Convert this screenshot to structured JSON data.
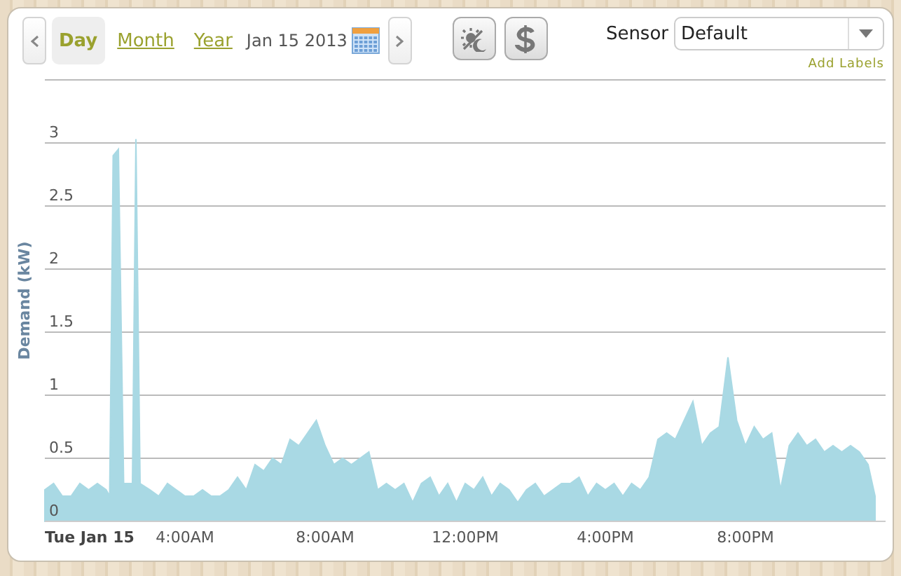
{
  "tabs": [
    {
      "label": "Day",
      "selected": true
    },
    {
      "label": "Month",
      "selected": false
    },
    {
      "label": "Year",
      "selected": false
    }
  ],
  "date": "Jan 15 2013",
  "sensor": {
    "label": "Sensor",
    "value": "Default"
  },
  "add_labels": "Add Labels",
  "chart_data": {
    "type": "area",
    "ylabel": "Demand (kW)",
    "x": [
      0,
      0.25,
      0.5,
      0.75,
      1,
      1.25,
      1.5,
      1.75,
      1.85,
      1.95,
      2.1,
      2.25,
      2.5,
      2.6,
      2.72,
      3,
      3.25,
      3.5,
      3.75,
      4,
      4.25,
      4.5,
      4.75,
      5,
      5.25,
      5.5,
      5.75,
      6,
      6.25,
      6.5,
      6.75,
      7,
      7.25,
      7.5,
      7.75,
      8,
      8.25,
      8.5,
      8.75,
      9,
      9.25,
      9.5,
      9.75,
      10,
      10.25,
      10.5,
      10.75,
      11,
      11.25,
      11.5,
      11.75,
      12,
      12.25,
      12.5,
      12.75,
      13,
      13.25,
      13.5,
      13.75,
      14,
      14.25,
      14.5,
      14.75,
      15,
      15.25,
      15.5,
      15.75,
      16,
      16.25,
      16.5,
      16.75,
      17,
      17.25,
      17.5,
      17.75,
      18,
      18.25,
      18.5,
      18.75,
      19,
      19.25,
      19.5,
      19.75,
      20,
      20.25,
      20.5,
      20.75,
      21,
      21.25,
      21.5,
      21.75,
      22,
      22.25,
      22.5,
      22.75,
      23,
      23.25,
      23.5,
      23.7
    ],
    "grid": true,
    "series": [
      {
        "color": "#a9d9e4",
        "values": [
          0.25,
          0.3,
          0.2,
          0.2,
          0.3,
          0.25,
          0.3,
          0.25,
          0.2,
          2.9,
          2.95,
          0.3,
          0.3,
          3.03,
          0.3,
          0.25,
          0.2,
          0.3,
          0.25,
          0.2,
          0.2,
          0.25,
          0.2,
          0.2,
          0.25,
          0.35,
          0.25,
          0.45,
          0.4,
          0.5,
          0.45,
          0.65,
          0.6,
          0.7,
          0.8,
          0.6,
          0.45,
          0.5,
          0.45,
          0.5,
          0.55,
          0.25,
          0.3,
          0.25,
          0.3,
          0.15,
          0.3,
          0.35,
          0.2,
          0.3,
          0.15,
          0.3,
          0.25,
          0.35,
          0.2,
          0.3,
          0.25,
          0.15,
          0.25,
          0.3,
          0.2,
          0.25,
          0.3,
          0.3,
          0.35,
          0.2,
          0.3,
          0.25,
          0.3,
          0.2,
          0.3,
          0.25,
          0.35,
          0.65,
          0.7,
          0.65,
          0.8,
          0.95,
          0.6,
          0.7,
          0.75,
          1.3,
          0.8,
          0.6,
          0.75,
          0.65,
          0.7,
          0.25,
          0.6,
          0.7,
          0.6,
          0.65,
          0.55,
          0.6,
          0.55,
          0.6,
          0.55,
          0.45,
          0.2
        ]
      }
    ],
    "xlim": [
      0,
      24
    ],
    "ylim": [
      0,
      3.5
    ],
    "yticks": [
      0,
      0.5,
      1,
      1.5,
      2,
      2.5,
      3
    ],
    "xticks": [
      {
        "value": 0,
        "label": "Tue Jan 15"
      },
      {
        "value": 4,
        "label": "4:00AM"
      },
      {
        "value": 8,
        "label": "8:00AM"
      },
      {
        "value": 12,
        "label": "12:00PM"
      },
      {
        "value": 16,
        "label": "4:00PM"
      },
      {
        "value": 20,
        "label": "8:00PM"
      }
    ]
  }
}
